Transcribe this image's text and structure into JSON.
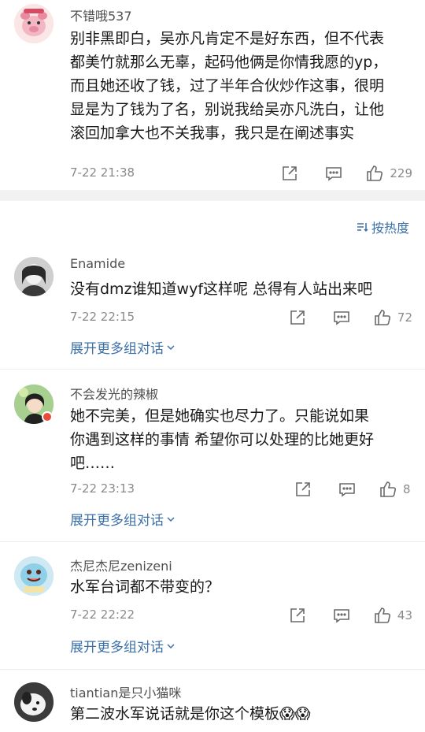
{
  "sort_label": "按热度",
  "comments": [
    {
      "username": "不错哦537",
      "lines": [
        "别非黑即白，吴亦凡肯定不是好东西，但不代表",
        "都美竹就那么无辜，起码他俩是你情我愿的yp，",
        "而且她还收了钱，过了半年合伙炒作这事，很明",
        "显是为了钱为了名，别说我给吴亦凡洗白，让他",
        "滚回加拿大也不关我事，我只是在阐述事实"
      ],
      "time": "7-22 21:38",
      "likes": "229"
    },
    {
      "username": "Enamide",
      "lines": [
        "没有dmz谁知道wyf这样呢 总得有人站出来吧"
      ],
      "time": "7-22 22:15",
      "likes": "72",
      "expand": "展开更多组对话"
    },
    {
      "username": "不会发光的辣椒",
      "lines": [
        "她不完美，但是她确实也尽力了。只能说如果",
        "你遇到这样的事情 希望你可以处理的比她更好",
        "吧……"
      ],
      "time": "7-22 23:13",
      "likes": "8",
      "expand": "展开更多组对话"
    },
    {
      "username": "杰尼杰尼zenizeni",
      "lines": [
        "水军台词都不带变的？"
      ],
      "time": "7-22 22:22",
      "likes": "43",
      "expand": "展开更多组对话"
    },
    {
      "username": "tiantian是只小猫咪",
      "lines": [
        "第二波水军说话就是你这个模板😱😱"
      ]
    }
  ],
  "colors": {
    "link_blue": "#3a6fa8",
    "meta_gray": "#8a8a8a",
    "section_gap": "#f2f2f2"
  }
}
